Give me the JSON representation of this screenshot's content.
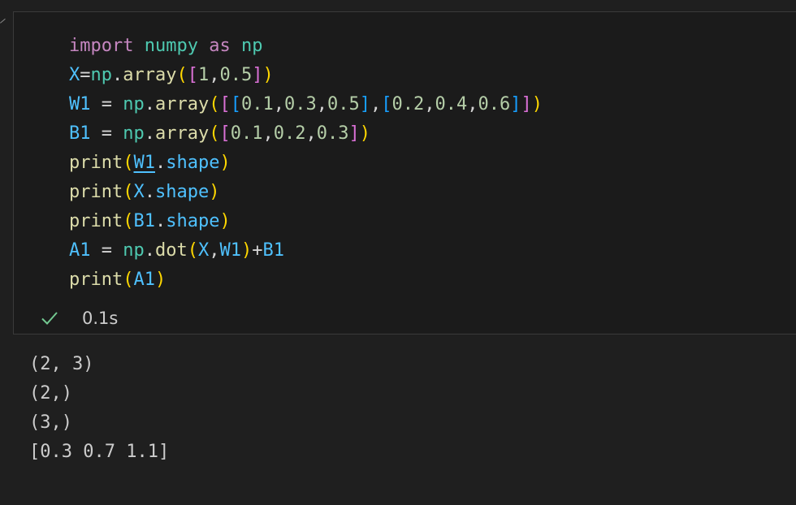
{
  "cell": {
    "code_lines": [
      [
        {
          "t": "import",
          "c": "kw"
        },
        {
          "t": " ",
          "c": "op"
        },
        {
          "t": "numpy",
          "c": "mod"
        },
        {
          "t": " ",
          "c": "op"
        },
        {
          "t": "as",
          "c": "kw"
        },
        {
          "t": " ",
          "c": "op"
        },
        {
          "t": "np",
          "c": "mod"
        }
      ],
      [
        {
          "t": "X",
          "c": "var"
        },
        {
          "t": "=",
          "c": "op"
        },
        {
          "t": "np",
          "c": "mod"
        },
        {
          "t": ".",
          "c": "op"
        },
        {
          "t": "array",
          "c": "fn"
        },
        {
          "t": "(",
          "c": "p1"
        },
        {
          "t": "[",
          "c": "p2"
        },
        {
          "t": "1",
          "c": "num"
        },
        {
          "t": ",",
          "c": "op"
        },
        {
          "t": "0.5",
          "c": "num"
        },
        {
          "t": "]",
          "c": "p2"
        },
        {
          "t": ")",
          "c": "p1"
        }
      ],
      [
        {
          "t": "W1",
          "c": "var"
        },
        {
          "t": " = ",
          "c": "op"
        },
        {
          "t": "np",
          "c": "mod"
        },
        {
          "t": ".",
          "c": "op"
        },
        {
          "t": "array",
          "c": "fn"
        },
        {
          "t": "(",
          "c": "p1"
        },
        {
          "t": "[",
          "c": "p2"
        },
        {
          "t": "[",
          "c": "p3"
        },
        {
          "t": "0.1",
          "c": "num"
        },
        {
          "t": ",",
          "c": "op"
        },
        {
          "t": "0.3",
          "c": "num"
        },
        {
          "t": ",",
          "c": "op"
        },
        {
          "t": "0.5",
          "c": "num"
        },
        {
          "t": "]",
          "c": "p3"
        },
        {
          "t": ",",
          "c": "op"
        },
        {
          "t": "[",
          "c": "p3"
        },
        {
          "t": "0.2",
          "c": "num"
        },
        {
          "t": ",",
          "c": "op"
        },
        {
          "t": "0.4",
          "c": "num"
        },
        {
          "t": ",",
          "c": "op"
        },
        {
          "t": "0.6",
          "c": "num"
        },
        {
          "t": "]",
          "c": "p3"
        },
        {
          "t": "]",
          "c": "p2"
        },
        {
          "t": ")",
          "c": "p1"
        }
      ],
      [
        {
          "t": "B1",
          "c": "var"
        },
        {
          "t": " = ",
          "c": "op"
        },
        {
          "t": "np",
          "c": "mod"
        },
        {
          "t": ".",
          "c": "op"
        },
        {
          "t": "array",
          "c": "fn"
        },
        {
          "t": "(",
          "c": "p1"
        },
        {
          "t": "[",
          "c": "p2"
        },
        {
          "t": "0.1",
          "c": "num"
        },
        {
          "t": ",",
          "c": "op"
        },
        {
          "t": "0.2",
          "c": "num"
        },
        {
          "t": ",",
          "c": "op"
        },
        {
          "t": "0.3",
          "c": "num"
        },
        {
          "t": "]",
          "c": "p2"
        },
        {
          "t": ")",
          "c": "p1"
        }
      ],
      [
        {
          "t": "print",
          "c": "fn"
        },
        {
          "t": "(",
          "c": "p1"
        },
        {
          "t": "W1",
          "c": "var under"
        },
        {
          "t": ".",
          "c": "op"
        },
        {
          "t": "shape",
          "c": "var"
        },
        {
          "t": ")",
          "c": "p1"
        }
      ],
      [
        {
          "t": "print",
          "c": "fn"
        },
        {
          "t": "(",
          "c": "p1"
        },
        {
          "t": "X",
          "c": "var"
        },
        {
          "t": ".",
          "c": "op"
        },
        {
          "t": "shape",
          "c": "var"
        },
        {
          "t": ")",
          "c": "p1"
        }
      ],
      [
        {
          "t": "print",
          "c": "fn"
        },
        {
          "t": "(",
          "c": "p1"
        },
        {
          "t": "B1",
          "c": "var"
        },
        {
          "t": ".",
          "c": "op"
        },
        {
          "t": "shape",
          "c": "var"
        },
        {
          "t": ")",
          "c": "p1"
        }
      ],
      [
        {
          "t": "A1",
          "c": "var"
        },
        {
          "t": " = ",
          "c": "op"
        },
        {
          "t": "np",
          "c": "mod"
        },
        {
          "t": ".",
          "c": "op"
        },
        {
          "t": "dot",
          "c": "fn"
        },
        {
          "t": "(",
          "c": "p1"
        },
        {
          "t": "X",
          "c": "var"
        },
        {
          "t": ",",
          "c": "op"
        },
        {
          "t": "W1",
          "c": "var"
        },
        {
          "t": ")",
          "c": "p1"
        },
        {
          "t": "+",
          "c": "op"
        },
        {
          "t": "B1",
          "c": "var"
        }
      ],
      [
        {
          "t": "print",
          "c": "fn"
        },
        {
          "t": "(",
          "c": "p1"
        },
        {
          "t": "A1",
          "c": "var"
        },
        {
          "t": ")",
          "c": "p1"
        }
      ]
    ],
    "status": {
      "icon": "check-icon",
      "exec_time": "0.1s",
      "color": "#73c991"
    }
  },
  "output": {
    "lines": [
      "(2, 3)",
      "(2,)",
      "(3,)",
      "[0.3 0.7 1.1]"
    ]
  }
}
